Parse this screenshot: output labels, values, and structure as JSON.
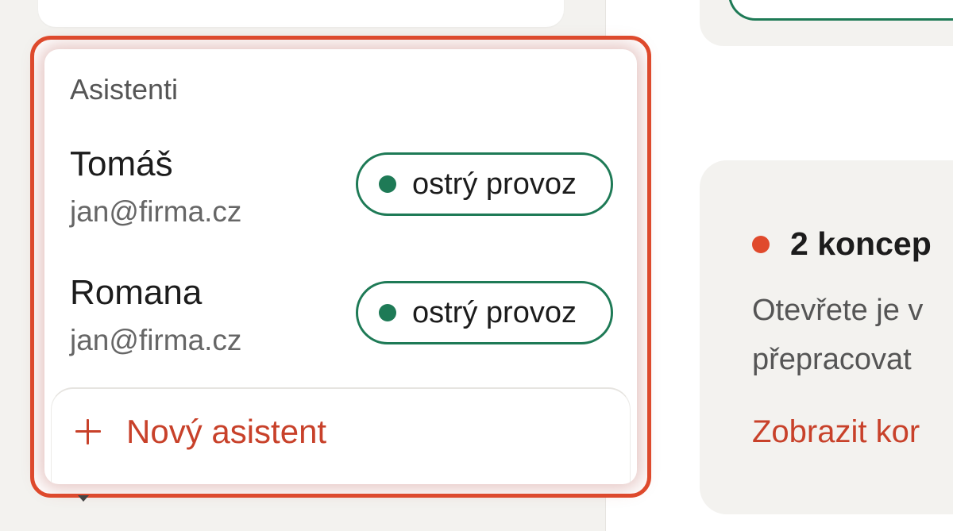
{
  "assistants_panel": {
    "heading": "Asistenti",
    "items": [
      {
        "name": "Tomáš",
        "email": "jan@firma.cz",
        "status": "ostrý provoz"
      },
      {
        "name": "Romana",
        "email": "jan@firma.cz",
        "status": "ostrý provoz"
      }
    ],
    "new_assistant_label": "Nový asistent"
  },
  "concepts_card": {
    "title": "2 koncep",
    "description_line1": "Otevřete je v",
    "description_line2": "přepracovat",
    "link": "Zobrazit kor"
  },
  "colors": {
    "accent_red": "#e04a2c",
    "link_red": "#c8412a",
    "status_green": "#1e7a56"
  },
  "icons": {
    "add": "plus-icon",
    "status": "status-dot-icon",
    "concepts": "alert-dot-icon"
  }
}
